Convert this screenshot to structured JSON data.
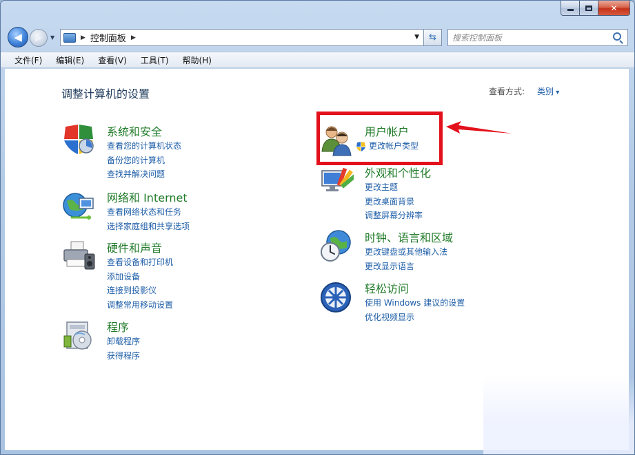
{
  "window": {
    "colors": {
      "accent": "#1e5ea8",
      "category_title": "#207b29",
      "highlight": "#e3111b"
    }
  },
  "address_bar": {
    "path": [
      "控制面板"
    ]
  },
  "search": {
    "placeholder": "搜索控制面板"
  },
  "menu": [
    "文件(F)",
    "编辑(E)",
    "查看(V)",
    "工具(T)",
    "帮助(H)"
  ],
  "content": {
    "title": "调整计算机的设置",
    "view_by_label": "查看方式:",
    "view_by_value": "类别"
  },
  "categories_left": [
    {
      "title": "系统和安全",
      "icon": "shield-icon",
      "links": [
        "查看您的计算机状态",
        "备份您的计算机",
        "查找并解决问题"
      ]
    },
    {
      "title": "网络和 Internet",
      "icon": "network-globe-icon",
      "links": [
        "查看网络状态和任务",
        "选择家庭组和共享选项"
      ]
    },
    {
      "title": "硬件和声音",
      "icon": "printer-icon",
      "links": [
        "查看设备和打印机",
        "添加设备",
        "连接到投影仪",
        "调整常用移动设置"
      ]
    },
    {
      "title": "程序",
      "icon": "programs-disc-icon",
      "links": [
        "卸载程序",
        "获得程序"
      ]
    }
  ],
  "categories_right": [
    {
      "title": "用户帐户",
      "icon": "user-accounts-icon",
      "links": [
        "更改帐户类型"
      ],
      "highlighted": true
    },
    {
      "title": "外观和个性化",
      "icon": "monitor-palette-icon",
      "links": [
        "更改主题",
        "更改桌面背景",
        "调整屏幕分辨率"
      ]
    },
    {
      "title": "时钟、语言和区域",
      "icon": "clock-globe-icon",
      "links": [
        "更改键盘或其他输入法",
        "更改显示语言"
      ]
    },
    {
      "title": "轻松访问",
      "icon": "ease-of-access-icon",
      "links": [
        "使用 Windows 建议的设置",
        "优化视频显示"
      ]
    }
  ]
}
